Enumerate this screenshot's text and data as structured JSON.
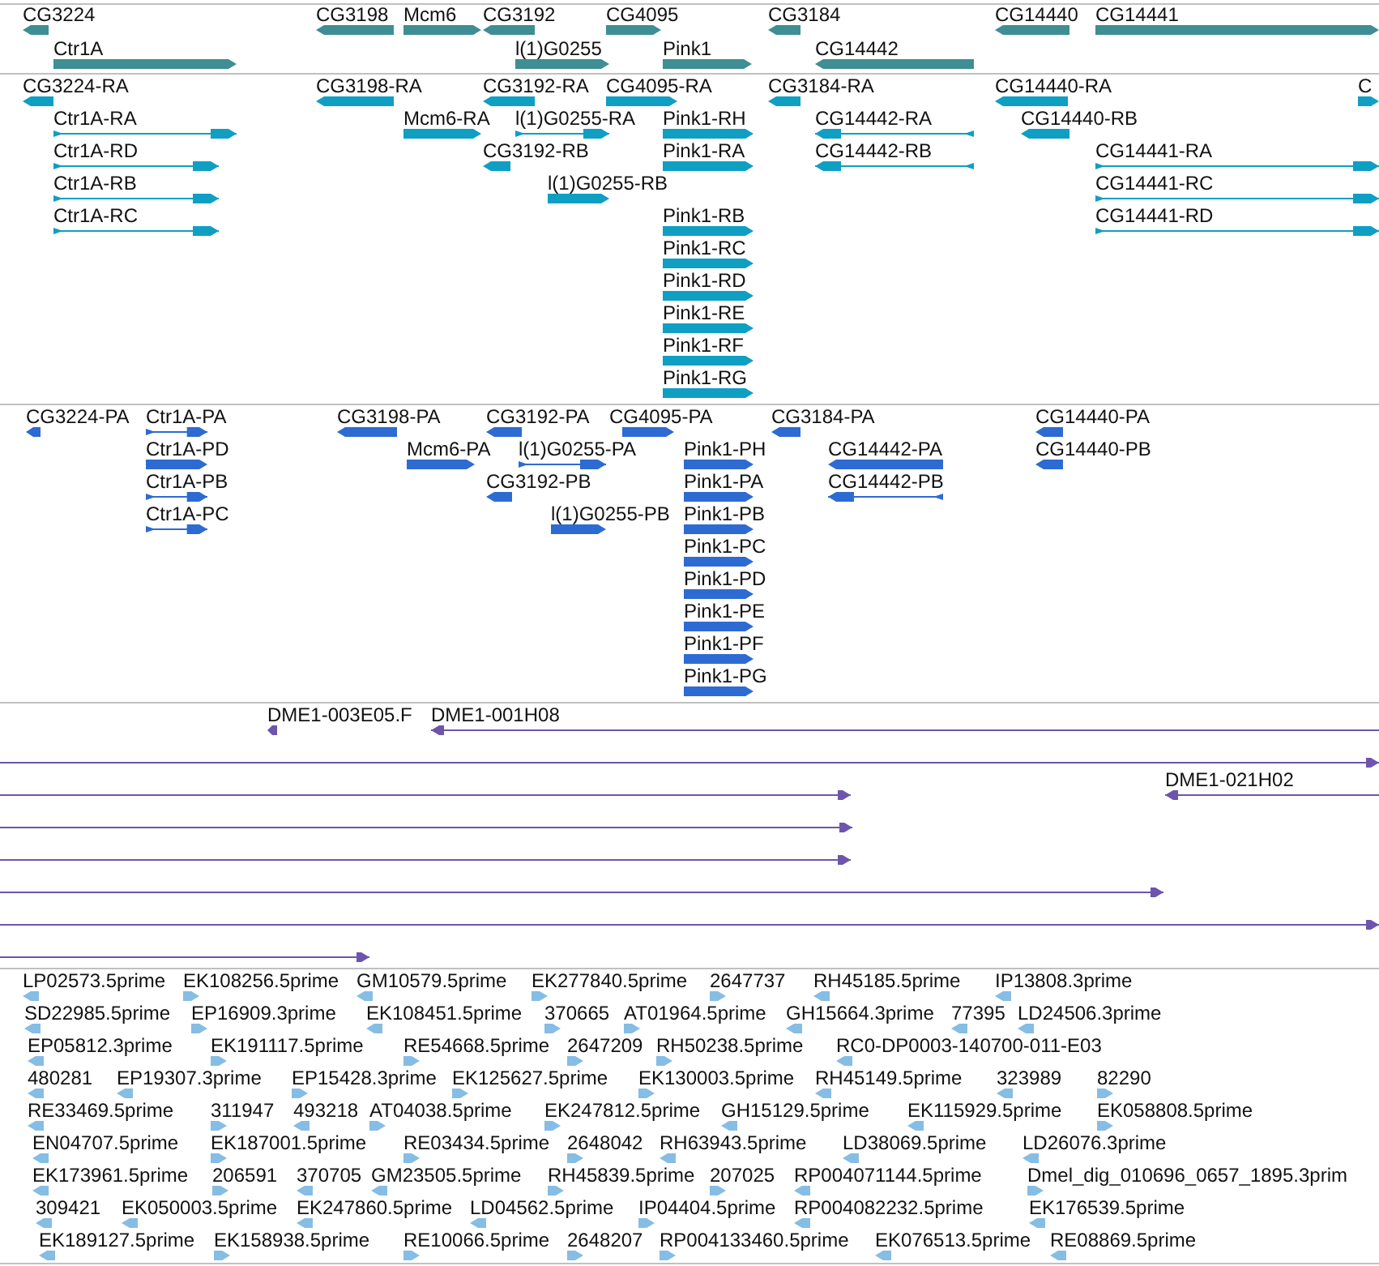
{
  "tracks": [
    {
      "kind": "gene",
      "rows": [
        {
          "features": [
            {
              "label": "CG3224",
              "reverse": true
            },
            {
              "label": "CG3198",
              "reverse": true
            },
            {
              "label": "Mcm6",
              "reverse": false
            },
            {
              "label": "CG3192",
              "reverse": true
            },
            {
              "label": "CG4095",
              "reverse": false
            },
            {
              "label": "CG3184",
              "reverse": true
            },
            {
              "label": "CG14440",
              "reverse": true
            },
            {
              "label": "CG14441",
              "reverse": false
            }
          ]
        },
        {
          "features": [
            {
              "label": "Ctr1A",
              "reverse": false
            },
            {
              "label": "l(1)G0255",
              "reverse": false
            },
            {
              "label": "Pink1",
              "reverse": false
            },
            {
              "label": "CG14442",
              "reverse": true
            }
          ]
        }
      ]
    },
    {
      "kind": "mrna",
      "rows": [
        {
          "features": [
            {
              "label": "CG3224-RA",
              "reverse": true
            },
            {
              "label": "CG3198-RA",
              "reverse": true
            },
            {
              "label": "CG3192-RA",
              "reverse": true
            },
            {
              "label": "CG4095-RA",
              "reverse": false
            },
            {
              "label": "CG3184-RA",
              "reverse": true
            },
            {
              "label": "CG14440-RA",
              "reverse": true
            },
            {
              "label": "C",
              "reverse": false
            }
          ]
        },
        {
          "features": [
            {
              "label": "Ctr1A-RA",
              "reverse": false
            },
            {
              "label": "Mcm6-RA",
              "reverse": false
            },
            {
              "label": "l(1)G0255-RA",
              "reverse": false
            },
            {
              "label": "Pink1-RH",
              "reverse": false
            },
            {
              "label": "CG14442-RA",
              "reverse": true
            },
            {
              "label": "CG14440-RB",
              "reverse": true
            }
          ]
        },
        {
          "features": [
            {
              "label": "Ctr1A-RD",
              "reverse": false
            },
            {
              "label": "CG3192-RB",
              "reverse": true
            },
            {
              "label": "Pink1-RA",
              "reverse": false
            },
            {
              "label": "CG14442-RB",
              "reverse": true
            },
            {
              "label": "CG14441-RA",
              "reverse": false
            }
          ]
        },
        {
          "features": [
            {
              "label": "Ctr1A-RB",
              "reverse": false
            },
            {
              "label": "l(1)G0255-RB",
              "reverse": false
            },
            {
              "label": "CG14441-RC",
              "reverse": false
            }
          ]
        },
        {
          "features": [
            {
              "label": "Ctr1A-RC",
              "reverse": false
            },
            {
              "label": "Pink1-RB",
              "reverse": false
            },
            {
              "label": "CG14441-RD",
              "reverse": false
            }
          ]
        },
        {
          "features": [
            {
              "label": "Pink1-RC",
              "reverse": false
            }
          ]
        },
        {
          "features": [
            {
              "label": "Pink1-RD",
              "reverse": false
            }
          ]
        },
        {
          "features": [
            {
              "label": "Pink1-RE",
              "reverse": false
            }
          ]
        },
        {
          "features": [
            {
              "label": "Pink1-RF",
              "reverse": false
            }
          ]
        },
        {
          "features": [
            {
              "label": "Pink1-RG",
              "reverse": false
            }
          ]
        }
      ]
    },
    {
      "kind": "protein",
      "rows": [
        {
          "features": [
            {
              "label": "CG3224-PA",
              "reverse": true
            },
            {
              "label": "Ctr1A-PA",
              "reverse": false
            },
            {
              "label": "CG3198-PA",
              "reverse": true
            },
            {
              "label": "CG3192-PA",
              "reverse": true
            },
            {
              "label": "CG4095-PA",
              "reverse": false
            },
            {
              "label": "CG3184-PA",
              "reverse": true
            },
            {
              "label": "CG14440-PA",
              "reverse": true
            }
          ]
        },
        {
          "features": [
            {
              "label": "Ctr1A-PD",
              "reverse": false
            },
            {
              "label": "Mcm6-PA",
              "reverse": false
            },
            {
              "label": "l(1)G0255-PA",
              "reverse": false
            },
            {
              "label": "Pink1-PH",
              "reverse": false
            },
            {
              "label": "CG14442-PA",
              "reverse": true
            },
            {
              "label": "CG14440-PB",
              "reverse": true
            }
          ]
        },
        {
          "features": [
            {
              "label": "Ctr1A-PB",
              "reverse": false
            },
            {
              "label": "CG3192-PB",
              "reverse": true
            },
            {
              "label": "Pink1-PA",
              "reverse": false
            },
            {
              "label": "CG14442-PB",
              "reverse": true
            }
          ]
        },
        {
          "features": [
            {
              "label": "Ctr1A-PC",
              "reverse": false
            },
            {
              "label": "l(1)G0255-PB",
              "reverse": false
            },
            {
              "label": "Pink1-PB",
              "reverse": false
            }
          ]
        },
        {
          "features": [
            {
              "label": "Pink1-PC",
              "reverse": false
            }
          ]
        },
        {
          "features": [
            {
              "label": "Pink1-PD",
              "reverse": false
            }
          ]
        },
        {
          "features": [
            {
              "label": "Pink1-PE",
              "reverse": false
            }
          ]
        },
        {
          "features": [
            {
              "label": "Pink1-PF",
              "reverse": false
            }
          ]
        },
        {
          "features": [
            {
              "label": "Pink1-PG",
              "reverse": false
            }
          ]
        }
      ]
    },
    {
      "kind": "cdna",
      "rows": [
        {
          "features": [
            {
              "label": "DME1-003E05.F",
              "reverse": true
            },
            {
              "label": "DME1-001H08",
              "reverse": true
            }
          ]
        },
        {
          "features": [
            {
              "reverse": false
            }
          ]
        },
        {
          "features": [
            {
              "reverse": false
            },
            {
              "label": "DME1-021H02",
              "reverse": true
            }
          ]
        },
        {
          "features": [
            {
              "reverse": false
            }
          ]
        },
        {
          "features": [
            {
              "reverse": false
            }
          ]
        },
        {
          "features": [
            {
              "reverse": false
            }
          ]
        },
        {
          "features": [
            {
              "reverse": false
            }
          ]
        },
        {
          "features": [
            {
              "reverse": false
            }
          ]
        }
      ]
    },
    {
      "kind": "est",
      "rows": [
        {
          "features": [
            {
              "label": "LP02573.5prime",
              "reverse": true
            },
            {
              "label": "EK108256.5prime",
              "reverse": false
            },
            {
              "label": "GM10579.5prime",
              "reverse": true
            },
            {
              "label": "EK277840.5prime",
              "reverse": false
            },
            {
              "label": "2647737",
              "reverse": false
            },
            {
              "label": "RH45185.5prime",
              "reverse": true
            },
            {
              "label": "IP13808.3prime",
              "reverse": true
            }
          ]
        },
        {
          "features": [
            {
              "label": "SD22985.5prime",
              "reverse": true
            },
            {
              "label": "EP16909.3prime",
              "reverse": false
            },
            {
              "label": "EK108451.5prime",
              "reverse": true
            },
            {
              "label": "370665",
              "reverse": false
            },
            {
              "label": "AT01964.5prime",
              "reverse": false
            },
            {
              "label": "GH15664.3prime",
              "reverse": true
            },
            {
              "label": "77395",
              "reverse": true
            },
            {
              "label": "LD24506.3prime",
              "reverse": true
            }
          ]
        },
        {
          "features": [
            {
              "label": "EP05812.3prime",
              "reverse": true
            },
            {
              "label": "EK191117.5prime",
              "reverse": false
            },
            {
              "label": "RE54668.5prime",
              "reverse": false
            },
            {
              "label": "2647209",
              "reverse": false
            },
            {
              "label": "RH50238.5prime",
              "reverse": false
            },
            {
              "label": "RC0-DP0003-140700-011-E03",
              "reverse": true
            }
          ]
        },
        {
          "features": [
            {
              "label": "480281",
              "reverse": true
            },
            {
              "label": "EP19307.3prime",
              "reverse": true
            },
            {
              "label": "EP15428.3prime",
              "reverse": false
            },
            {
              "label": "EK125627.5prime",
              "reverse": false
            },
            {
              "label": "EK130003.5prime",
              "reverse": false
            },
            {
              "label": "RH45149.5prime",
              "reverse": true
            },
            {
              "label": "323989",
              "reverse": true
            },
            {
              "label": "82290",
              "reverse": false
            }
          ]
        },
        {
          "features": [
            {
              "label": "RE33469.5prime",
              "reverse": true
            },
            {
              "label": "311947",
              "reverse": false
            },
            {
              "label": "493218",
              "reverse": true
            },
            {
              "label": "AT04038.5prime",
              "reverse": false
            },
            {
              "label": "EK247812.5prime",
              "reverse": false
            },
            {
              "label": "GH15129.5prime",
              "reverse": true
            },
            {
              "label": "EK115929.5prime",
              "reverse": true
            },
            {
              "label": "EK058808.5prime",
              "reverse": false
            }
          ]
        },
        {
          "features": [
            {
              "label": "EN04707.5prime",
              "reverse": true
            },
            {
              "label": "EK187001.5prime",
              "reverse": false
            },
            {
              "label": "RE03434.5prime",
              "reverse": false
            },
            {
              "label": "2648042",
              "reverse": false
            },
            {
              "label": "RH63943.5prime",
              "reverse": true
            },
            {
              "label": "LD38069.5prime",
              "reverse": true
            },
            {
              "label": "LD26076.3prime",
              "reverse": true
            }
          ]
        },
        {
          "features": [
            {
              "label": "EK173961.5prime",
              "reverse": true
            },
            {
              "label": "206591",
              "reverse": false
            },
            {
              "label": "370705",
              "reverse": true
            },
            {
              "label": "GM23505.5prime",
              "reverse": true
            },
            {
              "label": "RH45839.5prime",
              "reverse": false
            },
            {
              "label": "207025",
              "reverse": false
            },
            {
              "label": "RP004071144.5prime",
              "reverse": true
            },
            {
              "label": "Dmel_dig_010696_0657_1895.3prim",
              "reverse": false
            }
          ]
        },
        {
          "features": [
            {
              "label": "309421",
              "reverse": true
            },
            {
              "label": "EK050003.5prime",
              "reverse": true
            },
            {
              "label": "EK247860.5prime",
              "reverse": true
            },
            {
              "label": "LD04562.5prime",
              "reverse": true
            },
            {
              "label": "IP04404.5prime",
              "reverse": false
            },
            {
              "label": "RP004082232.5prime",
              "reverse": true
            },
            {
              "label": "EK176539.5prime",
              "reverse": true
            }
          ]
        },
        {
          "features": [
            {
              "label": "EK189127.5prime",
              "reverse": true
            },
            {
              "label": "EK158938.5prime",
              "reverse": false
            },
            {
              "label": "RE10066.5prime",
              "reverse": false
            },
            {
              "label": "2648207",
              "reverse": false
            },
            {
              "label": "RP004133460.5prime",
              "reverse": false
            },
            {
              "label": "EK076513.5prime",
              "reverse": true
            },
            {
              "label": "RE08869.5prime",
              "reverse": true
            }
          ]
        }
      ]
    }
  ]
}
